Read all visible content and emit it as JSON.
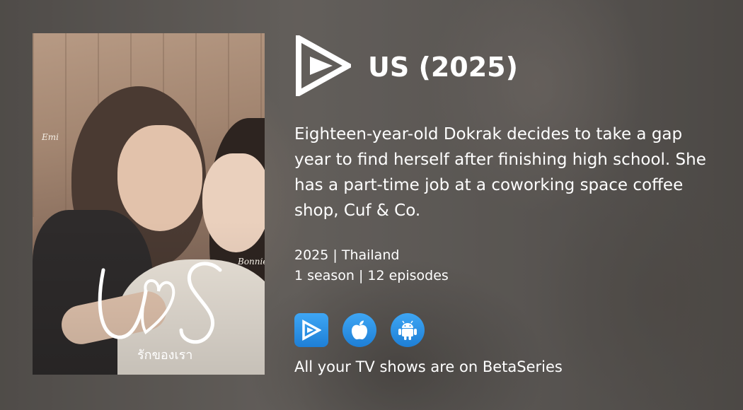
{
  "show": {
    "title": "US (2025)",
    "synopsis": "Eighteen-year-old Dokrak decides to take a gap year to find herself after finishing high school. She has a part-time job at a coworking space coffee shop, Cuf & Co.",
    "year_country": "2025 | Thailand",
    "seasons_episodes": "1 season | 12 episodes"
  },
  "poster": {
    "name_left": "Emi",
    "name_right": "Bonnie",
    "logo_text": "US",
    "thai_title": "รักของเรา"
  },
  "brand": {
    "logo_icon": "betaseries-play-logo-icon",
    "accent_color": "#2f93e8"
  },
  "stores": [
    {
      "icon": "betaseries-icon"
    },
    {
      "icon": "apple-icon"
    },
    {
      "icon": "android-icon"
    }
  ],
  "footer": {
    "text": "All your TV shows are on BetaSeries"
  }
}
